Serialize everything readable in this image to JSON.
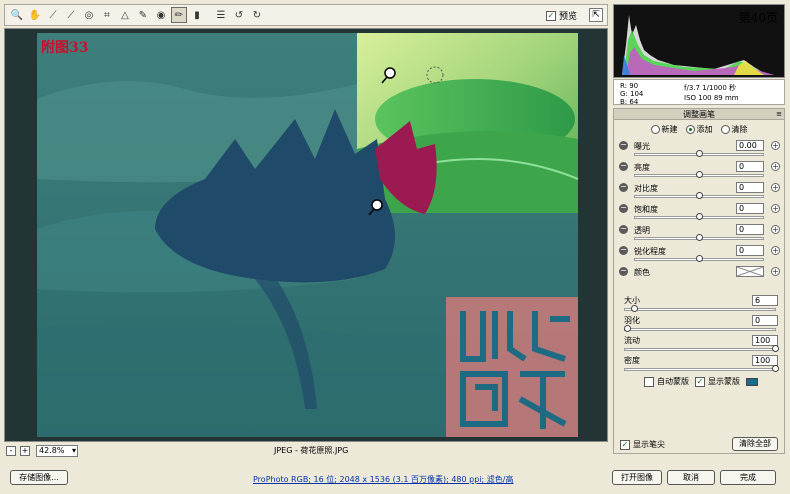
{
  "toolbar": {
    "tools": [
      {
        "name": "zoom-tool-icon",
        "glyph": "🔍"
      },
      {
        "name": "hand-tool-icon",
        "glyph": "✋"
      },
      {
        "name": "white-balance-tool-icon",
        "glyph": "⟋"
      },
      {
        "name": "color-sampler-tool-icon",
        "glyph": "⟋"
      },
      {
        "name": "target-adjust-tool-icon",
        "glyph": "◎"
      },
      {
        "name": "crop-tool-icon",
        "glyph": "⌗"
      },
      {
        "name": "straighten-tool-icon",
        "glyph": "△"
      },
      {
        "name": "spot-removal-tool-icon",
        "glyph": "✎"
      },
      {
        "name": "red-eye-tool-icon",
        "glyph": "◉"
      },
      {
        "name": "adjustment-brush-tool-icon",
        "glyph": "✏"
      },
      {
        "name": "graduated-filter-tool-icon",
        "glyph": "▮"
      },
      {
        "name": "preferences-icon",
        "glyph": "☰"
      },
      {
        "name": "rotate-left-icon",
        "glyph": "↺"
      },
      {
        "name": "rotate-right-icon",
        "glyph": "↻"
      }
    ],
    "preview_label": "预览",
    "preview_checked": "✓",
    "fullscreen_glyph": "⇱"
  },
  "canvas": {
    "figure_label": "附图33"
  },
  "status": {
    "zoom_minus": "-",
    "zoom_plus": "+",
    "zoom_value": "42.8%",
    "filename": "JPEG - 荷花原照.JPG"
  },
  "histogram": {
    "page_number": "第40页"
  },
  "info": {
    "r": "R:  90",
    "g": "G:  104",
    "b": "B:  64",
    "exposure_line": "f/3.7  1/1000 秒",
    "iso_line": "ISO 100  89 mm"
  },
  "panel": {
    "title": "调整画笔",
    "modes": [
      "新建",
      "添加",
      "清除"
    ],
    "selected_mode": 1,
    "sliders": [
      {
        "label": "曝光",
        "value": "0.00",
        "pos": 0.5
      },
      {
        "label": "亮度",
        "value": "0",
        "pos": 0.5
      },
      {
        "label": "对比度",
        "value": "0",
        "pos": 0.5
      },
      {
        "label": "饱和度",
        "value": "0",
        "pos": 0.5
      },
      {
        "label": "透明",
        "value": "0",
        "pos": 0.5
      },
      {
        "label": "锐化程度",
        "value": "0",
        "pos": 0.5
      }
    ],
    "color_label": "颜色",
    "brush": [
      {
        "label": "大小",
        "value": "6",
        "pos": 0.05
      },
      {
        "label": "羽化",
        "value": "0",
        "pos": 0.0
      },
      {
        "label": "流动",
        "value": "100",
        "pos": 1.0
      },
      {
        "label": "密度",
        "value": "100",
        "pos": 1.0
      }
    ],
    "auto_mask_label": "自动蒙版",
    "show_mask_label": "显示蒙版",
    "show_pins_label": "显示笔尖",
    "clear_all_label": "清除全部",
    "mask_color": "#1a6a8a"
  },
  "footer": {
    "save_label": "存储图像...",
    "workflow_text": "ProPhoto RGB; 16 位; 2048 x 1536 (3.1 百万像素); 480 ppi; 滤色/高",
    "open_label": "打开图像",
    "cancel_label": "取消",
    "done_label": "完成"
  }
}
